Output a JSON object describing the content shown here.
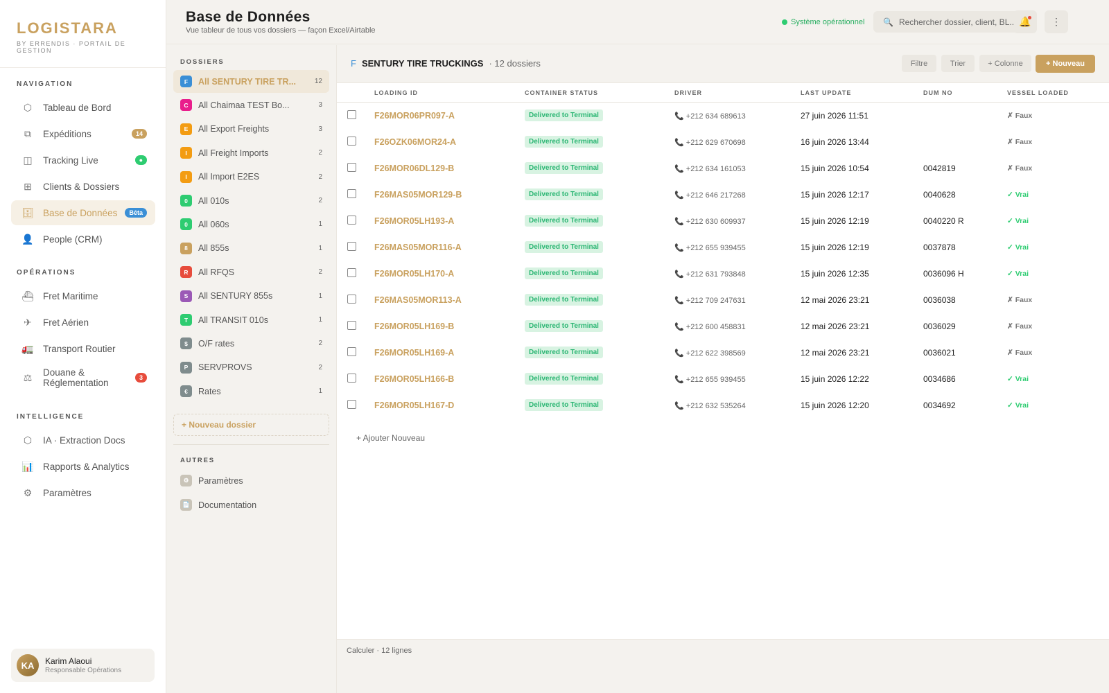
{
  "brand": {
    "name": "LOGISTARA",
    "subtitle": "BY ERRENDIS · PORTAIL DE GESTION"
  },
  "nav": {
    "navigation_title": "NAVIGATION",
    "navigation": [
      {
        "label": "Tableau de Bord",
        "icon": "hexagon-icon",
        "glyph": "⬡"
      },
      {
        "label": "Expéditions",
        "icon": "copy-icon",
        "glyph": "⧉",
        "badge": "14"
      },
      {
        "label": "Tracking Live",
        "icon": "map-icon",
        "glyph": "◫",
        "badge": "●"
      },
      {
        "label": "Clients & Dossiers",
        "icon": "grid-icon",
        "glyph": "⊞"
      },
      {
        "label": "Base de Données",
        "icon": "database-icon",
        "glyph": "🗄",
        "badge": "Bêta",
        "active": true
      },
      {
        "label": "People (CRM)",
        "icon": "user-icon",
        "glyph": "👤"
      }
    ],
    "operations_title": "OPÉRATIONS",
    "operations": [
      {
        "label": "Fret Maritime",
        "icon": "ship-icon",
        "glyph": "⛴"
      },
      {
        "label": "Fret Aérien",
        "icon": "plane-icon",
        "glyph": "✈"
      },
      {
        "label": "Transport Routier",
        "icon": "truck-icon",
        "glyph": "🚛"
      },
      {
        "label": "Douane & Réglementation",
        "icon": "scale-icon",
        "glyph": "⚖",
        "badge": "3"
      }
    ],
    "intelligence_title": "INTELLIGENCE",
    "intelligence": [
      {
        "label": "IA · Extraction Docs",
        "icon": "ai-icon",
        "glyph": "⬡"
      },
      {
        "label": "Rapports & Analytics",
        "icon": "chart-icon",
        "glyph": "📊"
      },
      {
        "label": "Paramètres",
        "icon": "gear-icon",
        "glyph": "⚙"
      }
    ]
  },
  "user": {
    "initials": "KA",
    "name": "Karim Alaoui",
    "role": "Responsable Opérations"
  },
  "header": {
    "title": "Base de Données",
    "subtitle": "Vue tableur de tous vos dossiers — façon Excel/Airtable",
    "status": "Système opérationnel",
    "search_placeholder": "Rechercher dossier, client, BL...",
    "notif_glyph": "🔔",
    "menu_glyph": "⋮"
  },
  "folders": {
    "title": "DOSSIERS",
    "items": [
      {
        "letter": "F",
        "label": "All SENTURY TIRE TR...",
        "count": "12",
        "color": "#3b8fd6",
        "active": true
      },
      {
        "letter": "C",
        "label": "All Chaimaa TEST Bo...",
        "count": "3",
        "color": "#e91e8c"
      },
      {
        "letter": "E",
        "label": "All Export Freights",
        "count": "3",
        "color": "#f39c12"
      },
      {
        "letter": "I",
        "label": "All Freight Imports",
        "count": "2",
        "color": "#f39c12"
      },
      {
        "letter": "I",
        "label": "All Import E2ES",
        "count": "2",
        "color": "#f39c12"
      },
      {
        "letter": "0",
        "label": "All 010s",
        "count": "2",
        "color": "#2ecc71"
      },
      {
        "letter": "0",
        "label": "All 060s",
        "count": "1",
        "color": "#2ecc71"
      },
      {
        "letter": "8",
        "label": "All 855s",
        "count": "1",
        "color": "#c9a15f"
      },
      {
        "letter": "R",
        "label": "All RFQS",
        "count": "2",
        "color": "#e74c3c"
      },
      {
        "letter": "S",
        "label": "All SENTURY 855s",
        "count": "1",
        "color": "#9b59b6"
      },
      {
        "letter": "T",
        "label": "All TRANSIT 010s",
        "count": "1",
        "color": "#2ecc71"
      },
      {
        "letter": "$",
        "label": "O/F rates",
        "count": "2",
        "color": "#7f8c8d"
      },
      {
        "letter": "P",
        "label": "SERVPROVS",
        "count": "2",
        "color": "#7f8c8d"
      },
      {
        "letter": "€",
        "label": "Rates",
        "count": "1",
        "color": "#7f8c8d"
      }
    ],
    "new_label": "+ Nouveau dossier",
    "others_title": "AUTRES",
    "others": [
      {
        "glyph": "⚙",
        "label": "Paramètres"
      },
      {
        "glyph": "📄",
        "label": "Documentation"
      }
    ]
  },
  "main": {
    "folder_letter": "F",
    "folder_name": "SENTURY TIRE TRUCKINGS",
    "folder_count": "· 12 dossiers",
    "buttons": {
      "filter": "Filtre",
      "sort": "Trier",
      "column": "+ Colonne",
      "new": "+ Nouveau"
    },
    "columns": [
      "LOADING ID",
      "CONTAINER STATUS",
      "DRIVER",
      "LAST UPDATE",
      "DUM NO",
      "VESSEL LOADED"
    ],
    "rows": [
      {
        "id": "F26MOR06PR097-A",
        "status": "Delivered to Terminal",
        "driver": "+212 634 689613",
        "update": "27 juin 2026 11:51",
        "dum": "",
        "vessel": "✗ Faux",
        "v": false
      },
      {
        "id": "F26OZK06MOR24-A",
        "status": "Delivered to Terminal",
        "driver": "+212 629 670698",
        "update": "16 juin 2026 13:44",
        "dum": "",
        "vessel": "✗ Faux",
        "v": false
      },
      {
        "id": "F26MOR06DL129-B",
        "status": "Delivered to Terminal",
        "driver": "+212 634 161053",
        "update": "15 juin 2026 10:54",
        "dum": "0042819",
        "vessel": "✗ Faux",
        "v": false
      },
      {
        "id": "F26MAS05MOR129-B",
        "status": "Delivered to Terminal",
        "driver": "+212 646 217268",
        "update": "15 juin 2026 12:17",
        "dum": "0040628",
        "vessel": "✓ Vrai",
        "v": true
      },
      {
        "id": "F26MOR05LH193-A",
        "status": "Delivered to Terminal",
        "driver": "+212 630 609937",
        "update": "15 juin 2026 12:19",
        "dum": "0040220 R",
        "vessel": "✓ Vrai",
        "v": true
      },
      {
        "id": "F26MAS05MOR116-A",
        "status": "Delivered to Terminal",
        "driver": "+212 655 939455",
        "update": "15 juin 2026 12:19",
        "dum": "0037878",
        "vessel": "✓ Vrai",
        "v": true
      },
      {
        "id": "F26MOR05LH170-A",
        "status": "Delivered to Terminal",
        "driver": "+212 631 793848",
        "update": "15 juin 2026 12:35",
        "dum": "0036096 H",
        "vessel": "✓ Vrai",
        "v": true
      },
      {
        "id": "F26MAS05MOR113-A",
        "status": "Delivered to Terminal",
        "driver": "+212 709 247631",
        "update": "12 mai 2026 23:21",
        "dum": "0036038",
        "vessel": "✗ Faux",
        "v": false
      },
      {
        "id": "F26MOR05LH169-B",
        "status": "Delivered to Terminal",
        "driver": "+212 600 458831",
        "update": "12 mai 2026 23:21",
        "dum": "0036029",
        "vessel": "✗ Faux",
        "v": false
      },
      {
        "id": "F26MOR05LH169-A",
        "status": "Delivered to Terminal",
        "driver": "+212 622 398569",
        "update": "12 mai 2026 23:21",
        "dum": "0036021",
        "vessel": "✗ Faux",
        "v": false
      },
      {
        "id": "F26MOR05LH166-B",
        "status": "Delivered to Terminal",
        "driver": "+212 655 939455",
        "update": "15 juin 2026 12:22",
        "dum": "0034686",
        "vessel": "✓ Vrai",
        "v": true
      },
      {
        "id": "F26MOR05LH167-D",
        "status": "Delivered to Terminal",
        "driver": "+212 632 535264",
        "update": "15 juin 2026 12:20",
        "dum": "0034692",
        "vessel": "✓ Vrai",
        "v": true
      }
    ],
    "add_new": "+ Ajouter Nouveau",
    "footer": "Calculer · 12 lignes"
  }
}
